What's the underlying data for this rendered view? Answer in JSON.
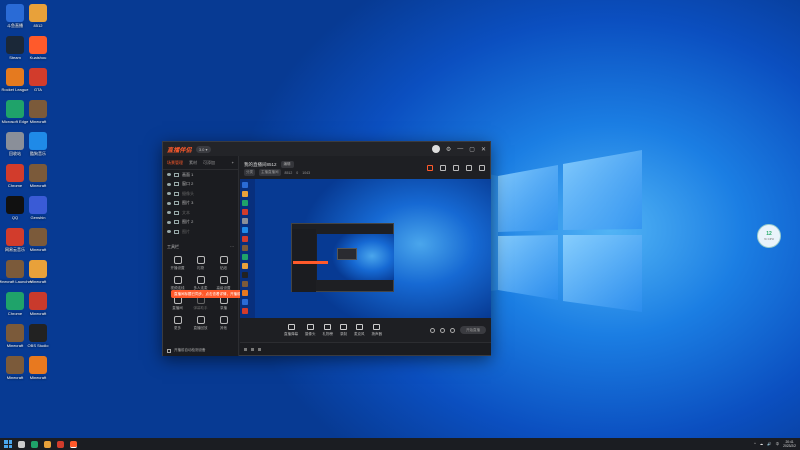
{
  "colors": {
    "accent": "#ff5a2b",
    "wallpaper": "#1b7ee3",
    "app_bg": "#1e1f23",
    "taskbar": "#1b1d22"
  },
  "desktop": {
    "icons": [
      {
        "label": "斗鱼直播",
        "icon": "app-icon",
        "color": "#2a6bd6"
      },
      {
        "label": "8512",
        "icon": "folder-icon",
        "color": "#e8a13a"
      },
      {
        "label": "Steam",
        "icon": "steam-icon",
        "color": "#1b2838"
      },
      {
        "label": "Kuaishou",
        "icon": "kuaishou-icon",
        "color": "#ff5a2b"
      },
      {
        "label": "Rocket League",
        "icon": "game-icon",
        "color": "#e57a1f"
      },
      {
        "label": "GTA",
        "icon": "game-icon",
        "color": "#d23c2c"
      },
      {
        "label": "Microsoft Edge",
        "icon": "edge-icon",
        "color": "#1fa36a"
      },
      {
        "label": "Minecraft",
        "icon": "game-icon",
        "color": "#7b5a3a"
      },
      {
        "label": "回收站",
        "icon": "recycle-bin-icon",
        "color": "#8a8f99"
      },
      {
        "label": "酷狗音乐",
        "icon": "music-icon",
        "color": "#1f8ae8"
      },
      {
        "label": "Chrome",
        "icon": "chrome-icon",
        "color": "#d23c2c"
      },
      {
        "label": "Minecraft",
        "icon": "game-icon",
        "color": "#7b5a3a"
      },
      {
        "label": "QQ",
        "icon": "qq-icon",
        "color": "#111"
      },
      {
        "label": "Genshin",
        "icon": "game-icon",
        "color": "#3a5bd6"
      },
      {
        "label": "网易云音乐",
        "icon": "music-icon",
        "color": "#d23c2c"
      },
      {
        "label": "Minecraft",
        "icon": "game-icon",
        "color": "#7b5a3a"
      },
      {
        "label": "Minecraft Launcher",
        "icon": "game-icon",
        "color": "#7b5a3a"
      },
      {
        "label": "Minecraft",
        "icon": "game-icon",
        "color": "#e8a13a"
      },
      {
        "label": "Chrome",
        "icon": "chrome-icon",
        "color": "#1fa36a"
      },
      {
        "label": "Minecraft",
        "icon": "game-icon",
        "color": "#c93a2c"
      },
      {
        "label": "Minecraft",
        "icon": "game-icon",
        "color": "#7b5a3a"
      },
      {
        "label": "OBS Studio",
        "icon": "obs-icon",
        "color": "#222"
      },
      {
        "label": "Minecraft",
        "icon": "game-icon",
        "color": "#7b5a3a"
      },
      {
        "label": "Minecraft",
        "icon": "game-icon",
        "color": "#e8791f"
      }
    ],
    "widget": {
      "value": "12",
      "sub": "% CPU"
    }
  },
  "app": {
    "logo": "直播伴侣",
    "badge": "3.0 ▾",
    "window_controls": [
      "⚙",
      "—",
      "▢",
      "✕"
    ],
    "tabs": [
      {
        "label": "场景管理",
        "active": true
      },
      {
        "label": "素材",
        "active": false
      },
      {
        "label": "可添加",
        "active": false
      }
    ],
    "tab_add": "+",
    "scenes": [
      {
        "name": "画面 1",
        "dim": false
      },
      {
        "name": "窗口 2",
        "dim": false
      },
      {
        "name": "摄像头",
        "dim": true
      },
      {
        "name": "图片 3",
        "dim": false
      },
      {
        "name": "文本",
        "dim": true
      },
      {
        "name": "图片 2",
        "dim": false
      },
      {
        "name": "图片",
        "dim": true
      }
    ],
    "tools_title": "工具栏",
    "tools_more": "···",
    "tools": [
      {
        "label": "开播设置",
        "dim": false
      },
      {
        "label": "礼物",
        "dim": false
      },
      {
        "label": "贴纸",
        "dim": false
      },
      {
        "label": "视频连线",
        "dim": false
      },
      {
        "label": "多人连麦",
        "dim": false
      },
      {
        "label": "高级设置",
        "dim": false
      },
      {
        "label": "直播间",
        "dim": false
      },
      {
        "label": "弹幕助手",
        "dim": true
      },
      {
        "label": "录播",
        "dim": false
      },
      {
        "label": "更多",
        "dim": false
      },
      {
        "label": "直播回放",
        "dim": false
      },
      {
        "label": "其他",
        "dim": false
      }
    ],
    "notice": "直播间标题已同步，点击查看详情，开播前请检查设置",
    "notice_close": "✕",
    "footer_checkbox_label": "开播前自动检测设备",
    "room": {
      "title": "我的直播间8512",
      "tag": "编辑",
      "meta": [
        "分类",
        "主播直播间",
        "8512",
        "0"
      ],
      "fans": "1043"
    },
    "toolbar": [
      {
        "label": "直播弹幕",
        "icon": "danmaku-icon"
      },
      {
        "label": "摄像头",
        "icon": "camera-icon"
      },
      {
        "label": "礼物榜",
        "icon": "gift-icon"
      },
      {
        "label": "录制",
        "icon": "record-icon"
      },
      {
        "label": "麦克风",
        "icon": "mic-icon"
      },
      {
        "label": "扬声器",
        "icon": "speaker-icon"
      }
    ],
    "start_live": "开始直播"
  },
  "taskbar": {
    "apps": [
      {
        "name": "windows-start",
        "color": "#4aa6ec"
      },
      {
        "name": "search",
        "color": "#ccc"
      },
      {
        "name": "edge",
        "color": "#1fa36a"
      },
      {
        "name": "chrome",
        "color": "#e8a13a"
      },
      {
        "name": "app",
        "color": "#d23c2c"
      },
      {
        "name": "streaming-app",
        "color": "#ff5a2b"
      }
    ],
    "tray": [
      "^",
      "☁",
      "🔊",
      "中"
    ],
    "time": "20:41",
    "date": "2023/2/2"
  }
}
